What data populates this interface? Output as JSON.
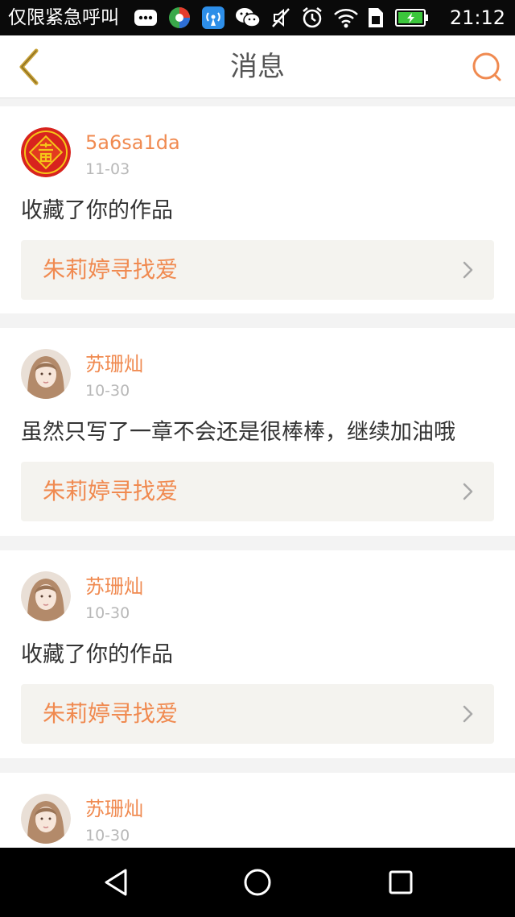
{
  "status_bar": {
    "carrier": "仅限紧急呼叫",
    "time": "21:12",
    "icons": [
      "message-icon",
      "app-icon",
      "wifi-hotspot-icon",
      "wechat-icon",
      "mute-icon",
      "alarm-icon",
      "wifi-icon",
      "sim-icon",
      "battery-icon"
    ]
  },
  "header": {
    "title": "消息",
    "back_icon": "chevron-left-icon",
    "search_icon": "search-icon"
  },
  "colors": {
    "accent": "#f08a50",
    "back_icon": "#c8a23a",
    "date": "#b8b8b8",
    "text": "#333333",
    "card_link_bg": "#f4f3ef",
    "page_bg": "#f3f3f3"
  },
  "messages": [
    {
      "user": "5a6sa1da",
      "date": "11-03",
      "text": "收藏了你的作品",
      "work": "朱莉婷寻找爱",
      "avatar": "fu-avatar"
    },
    {
      "user": "苏珊灿",
      "date": "10-30",
      "text": "虽然只写了一章不会还是很棒棒，继续加油哦",
      "work": "朱莉婷寻找爱",
      "avatar": "girl-avatar"
    },
    {
      "user": "苏珊灿",
      "date": "10-30",
      "text": "收藏了你的作品",
      "work": "朱莉婷寻找爱",
      "avatar": "girl-avatar"
    },
    {
      "user": "苏珊灿",
      "date": "10-30",
      "text": "",
      "work": "",
      "avatar": "girl-avatar"
    }
  ],
  "nav_bar": {
    "buttons": [
      "back-triangle-icon",
      "home-circle-icon",
      "recents-square-icon"
    ]
  }
}
